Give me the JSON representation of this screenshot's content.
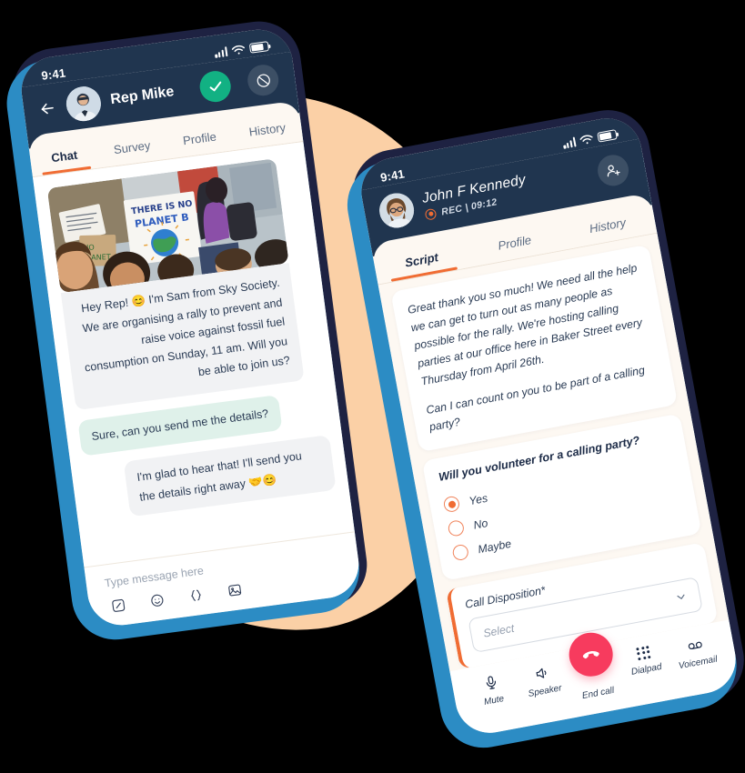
{
  "phone_one": {
    "status": {
      "time": "9:41",
      "signal_icon": "signal-bars-icon",
      "wifi_icon": "wifi-icon",
      "battery_icon": "battery-icon"
    },
    "header": {
      "back_icon": "back-arrow-icon",
      "avatar": "rep-avatar",
      "name": "Rep Mike",
      "accept_icon": "check-icon",
      "reject_icon": "block-icon"
    },
    "tabs": [
      {
        "label": "Chat",
        "active": true
      },
      {
        "label": "Survey",
        "active": false
      },
      {
        "label": "Profile",
        "active": false
      },
      {
        "label": "History",
        "active": false
      }
    ],
    "messages": [
      {
        "type": "image_text",
        "side": "in",
        "image_alt": "climate rally protest photo with sign reading THERE IS NO PLANET B",
        "text": "Hey Rep! 😊 I'm Sam from Sky Society. We are organising a rally to prevent and raise voice against fossil fuel consumption on Sunday, 11 am. Will you be able to join us?"
      },
      {
        "type": "text",
        "side": "in",
        "style": "mint",
        "text": "Sure, can you send me the details?"
      },
      {
        "type": "text",
        "side": "out",
        "style": "grey",
        "text": "I'm glad to hear that! I'll send you the details right away 🤝😊"
      }
    ],
    "composer": {
      "placeholder": "Type message here",
      "icons": [
        "signature-icon",
        "emoji-icon",
        "merge-field-icon",
        "image-icon"
      ]
    }
  },
  "phone_two": {
    "status": {
      "time": "9:41",
      "signal_icon": "signal-bars-icon",
      "wifi_icon": "wifi-icon",
      "battery_icon": "battery-icon"
    },
    "header": {
      "avatar": "contact-avatar",
      "name": "John F Kennedy",
      "rec_icon": "record-icon",
      "rec_label": "REC | 09:12",
      "add_contact_icon": "add-person-icon"
    },
    "tabs": [
      {
        "label": "Script",
        "active": true
      },
      {
        "label": "Profile",
        "active": false
      },
      {
        "label": "History",
        "active": false
      }
    ],
    "script": {
      "paragraph_1": "Great thank you so much! We need all the help we can get to turn out as many people as possible for the rally. We're hosting calling parties at our office here in Baker Street every Thursday from April 26th.",
      "paragraph_2": "Can I can count on you to be part of a calling party?"
    },
    "survey": {
      "question": "Will you volunteer for a calling party?",
      "options": [
        {
          "label": "Yes",
          "selected": true
        },
        {
          "label": "No",
          "selected": false
        },
        {
          "label": "Maybe",
          "selected": false
        }
      ]
    },
    "disposition": {
      "label": "Call Disposition*",
      "placeholder": "Select",
      "chevron_icon": "chevron-down-icon"
    },
    "call_bar": [
      {
        "label": "Mute",
        "icon": "microphone-icon"
      },
      {
        "label": "Speaker",
        "icon": "speaker-icon"
      },
      {
        "label": "End call",
        "icon": "end-call-icon"
      },
      {
        "label": "Dialpad",
        "icon": "dialpad-icon"
      },
      {
        "label": "Voicemail",
        "icon": "voicemail-icon"
      }
    ]
  },
  "colors": {
    "frame_navy": "#1e2242",
    "header_navy": "#20354f",
    "accent_blue": "#2c8cc4",
    "accent_orange": "#f06c33",
    "accept_green": "#12b183",
    "end_call_red": "#f73b5e",
    "blob_peach": "#fbd0a6",
    "bubble_mint": "#dff1ea",
    "bubble_grey": "#f1f2f4"
  }
}
